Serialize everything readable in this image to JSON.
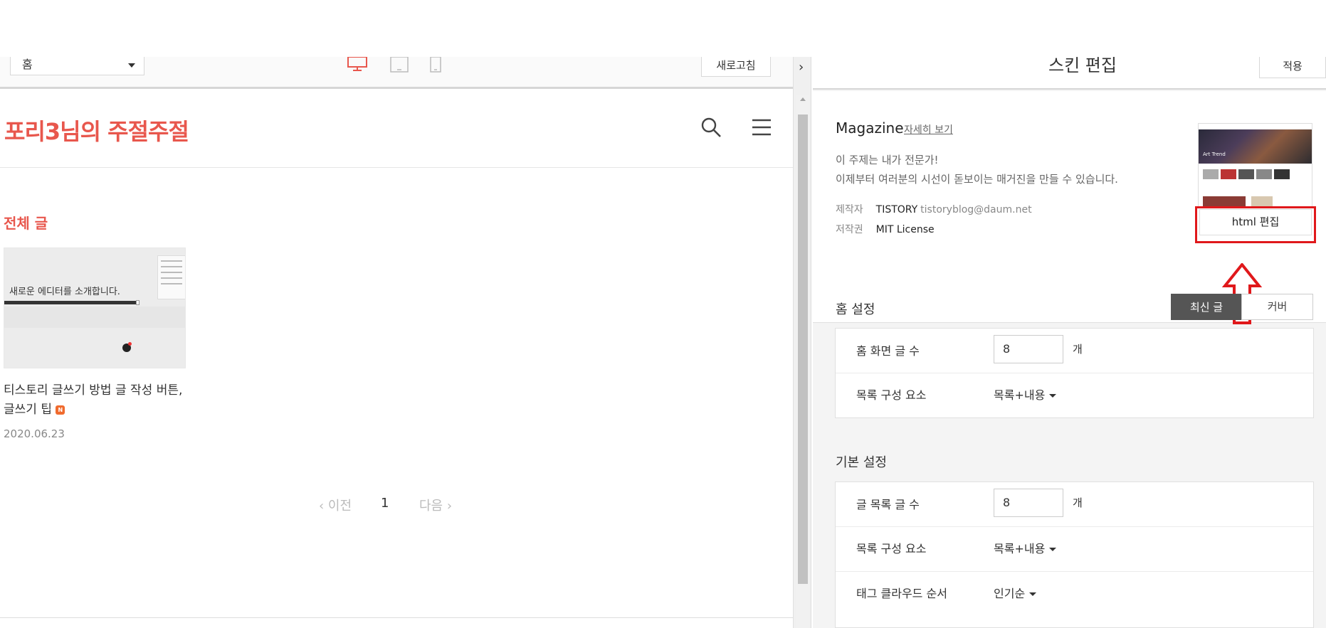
{
  "toolbar": {
    "page_select": "홈",
    "refresh_label": "새로고침"
  },
  "blog": {
    "title": "포리3님의 주절주절",
    "category_title": "전체 글",
    "post": {
      "thumb_text": "새로운 에디터를 소개합니다.",
      "title": "티스토리 글쓰기 방법 글 작성 버튼, 글쓰기 팁",
      "new_badge": "N",
      "date": "2020.06.23"
    },
    "pager": {
      "prev": "이전",
      "current": "1",
      "next": "다음"
    }
  },
  "panel": {
    "title": "스킨 편집",
    "apply_label": "적용",
    "skin": {
      "name": "Magazine",
      "more_link": "자세히 보기",
      "desc_line1": "이 주제는 내가 전문가!",
      "desc_line2": "이제부터 여러분의 시선이 돋보이는 매거진을 만들 수 있습니다.",
      "maker_label": "제작자",
      "maker_value": "TISTORY",
      "maker_email": "tistoryblog@daum.net",
      "license_label": "저작권",
      "license_value": "MIT License",
      "preview_caption": "Art Trend",
      "html_edit_label": "html 편집"
    },
    "home_settings": {
      "title": "홈 설정",
      "toggle_active": "최신 글",
      "toggle_other": "커버",
      "post_count_label": "홈 화면 글 수",
      "post_count_value": "8",
      "unit": "개",
      "list_comp_label": "목록 구성 요소",
      "list_comp_value": "목록+내용"
    },
    "basic_settings": {
      "title": "기본 설정",
      "post_count_label": "글 목록 글 수",
      "post_count_value": "8",
      "unit": "개",
      "list_comp_label": "목록 구성 요소",
      "list_comp_value": "목록+내용",
      "tag_order_label": "태그 클라우드 순서",
      "tag_order_value": "인기순"
    }
  },
  "colors": {
    "accent": "#e8574d",
    "highlight_red": "#e0181b",
    "dark_toggle": "#555555"
  }
}
